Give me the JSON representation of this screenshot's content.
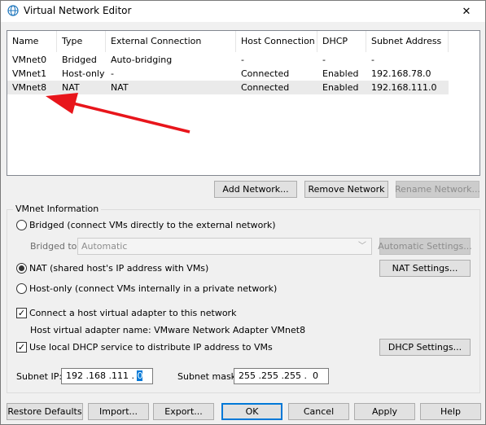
{
  "window": {
    "title": "Virtual Network Editor",
    "close_glyph": "✕",
    "icon": "globe-icon"
  },
  "table": {
    "columns": [
      "Name",
      "Type",
      "External Connection",
      "Host Connection",
      "DHCP",
      "Subnet Address"
    ],
    "rows": [
      {
        "name": "VMnet0",
        "type": "Bridged",
        "external": "Auto-bridging",
        "host": "-",
        "dhcp": "-",
        "subnet": "-"
      },
      {
        "name": "VMnet1",
        "type": "Host-only",
        "external": "-",
        "host": "Connected",
        "dhcp": "Enabled",
        "subnet": "192.168.78.0"
      },
      {
        "name": "VMnet8",
        "type": "NAT",
        "external": "NAT",
        "host": "Connected",
        "dhcp": "Enabled",
        "subnet": "192.168.111.0"
      }
    ]
  },
  "network_buttons": {
    "add": "Add Network...",
    "remove": "Remove Network",
    "rename": "Rename Network..."
  },
  "vmnet_info": {
    "group_title": "VMnet Information",
    "bridged_label": "Bridged (connect VMs directly to the external network)",
    "bridged_to_label": "Bridged to:",
    "bridged_to_value": "Automatic",
    "auto_settings": "Automatic Settings...",
    "nat_label": "NAT (shared host's IP address with VMs)",
    "nat_settings": "NAT Settings...",
    "hostonly_label": "Host-only (connect VMs internally in a private network)",
    "connect_adapter_label": "Connect a host virtual adapter to this network",
    "adapter_name_label": "Host virtual adapter name: VMware Network Adapter VMnet8",
    "dhcp_label": "Use local DHCP service to distribute IP address to VMs",
    "dhcp_settings": "DHCP Settings...",
    "subnet_ip_label": "Subnet IP:",
    "subnet_ip_main": "192 .168 .111 . ",
    "subnet_ip_selected": "0",
    "subnet_mask_label": "Subnet mask:",
    "subnet_mask_value": "255 .255 .255 .  0",
    "selected_mode": "nat",
    "connect_adapter_checked": true,
    "dhcp_checked": true,
    "check_glyph": "✓"
  },
  "footer": {
    "restore": "Restore Defaults",
    "import": "Import...",
    "export": "Export...",
    "ok": "OK",
    "cancel": "Cancel",
    "apply": "Apply",
    "help": "Help"
  },
  "colors": {
    "accent": "#0078d7",
    "arrow": "#e8151b",
    "selection": "#eaeaea"
  }
}
